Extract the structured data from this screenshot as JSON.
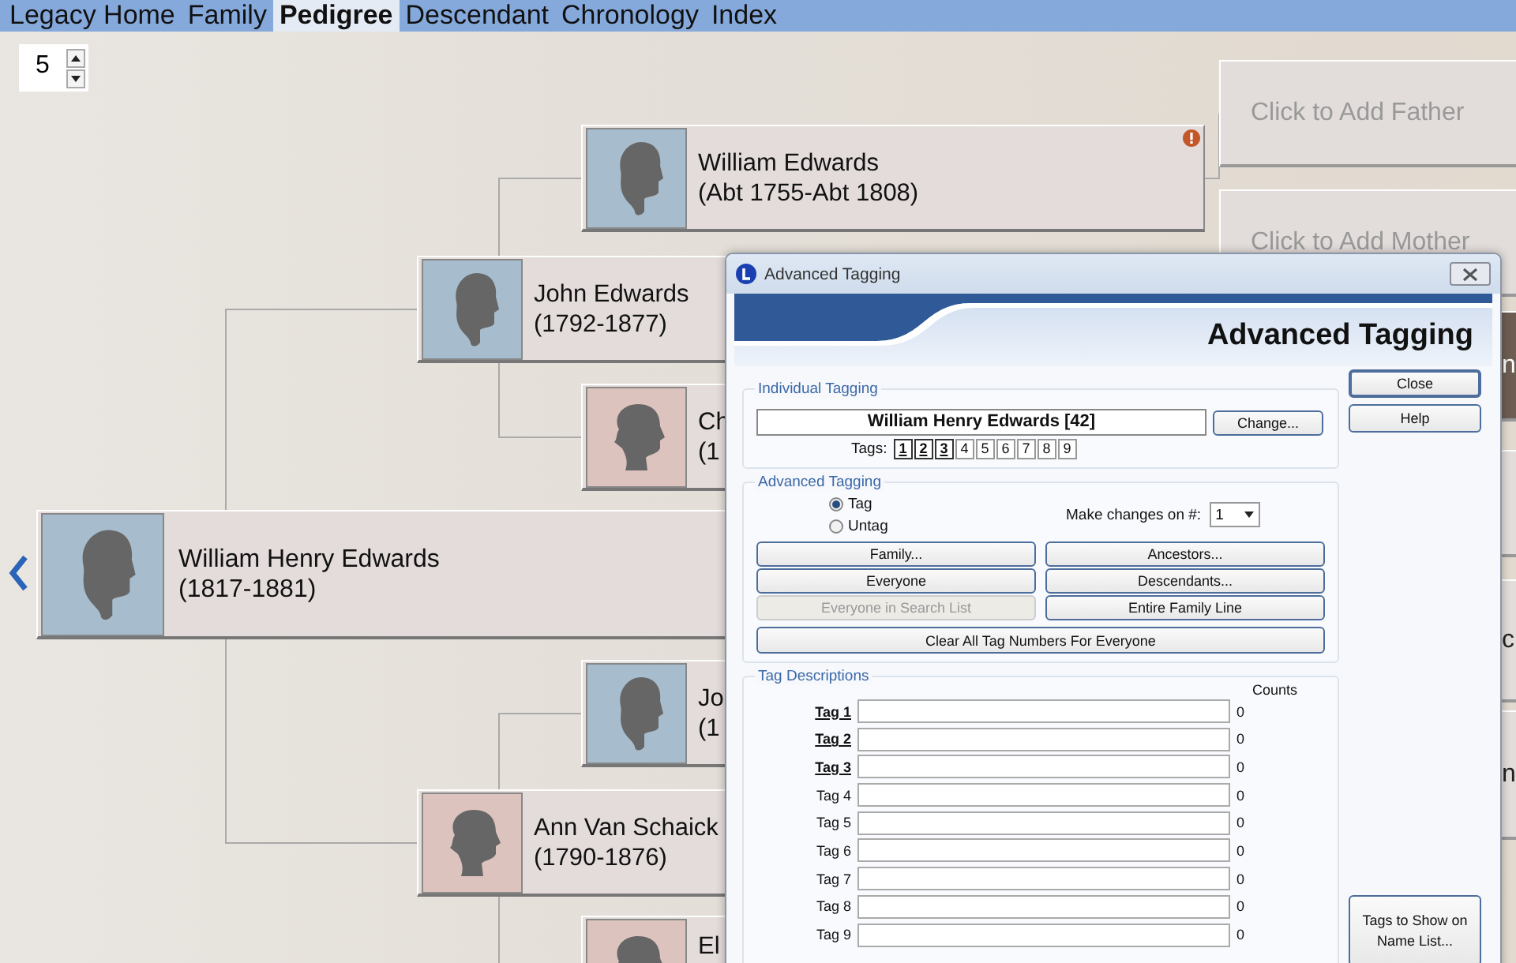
{
  "tabs": [
    {
      "label": "Legacy Home",
      "selected": false
    },
    {
      "label": "Family",
      "selected": false
    },
    {
      "label": "Pedigree",
      "selected": true
    },
    {
      "label": "Descendant",
      "selected": false
    },
    {
      "label": "Chronology",
      "selected": false
    },
    {
      "label": "Index",
      "selected": false
    }
  ],
  "generations": "5",
  "people": [
    {
      "name": "William Edwards",
      "dates": "(Abt 1755-Abt 1808)",
      "kind": "male",
      "alert": true
    },
    {
      "name": "John Edwards",
      "dates": "(1792-1877)",
      "kind": "male"
    },
    {
      "name": "Ch",
      "dates": "(1",
      "kind": "female"
    },
    {
      "name": "William Henry Edwards",
      "dates": "(1817-1881)",
      "kind": "male"
    },
    {
      "name": "Jo",
      "dates": "(1",
      "kind": "male"
    },
    {
      "name": "Ann Van Schaick",
      "dates": "(1790-1876)",
      "kind": "female"
    },
    {
      "name": "El",
      "kind": "female"
    }
  ],
  "add_boxes": [
    {
      "label": "Click to Add Father"
    },
    {
      "label": "Click to Add Mother"
    }
  ],
  "edge_boxes": [
    {
      "text": "n",
      "highlighted": true
    },
    {
      "highlighted": false
    },
    {
      "text": "c",
      "highlighted": false
    },
    {
      "text": "n",
      "highlighted": false
    }
  ],
  "dialog": {
    "title": "Advanced Tagging",
    "heading": "Advanced Tagging",
    "individual": {
      "legend": "Individual Tagging",
      "person": "William Henry Edwards [42]",
      "change": "Change...",
      "tags_label": "Tags:",
      "tags": [
        {
          "label": "1",
          "set": true
        },
        {
          "label": "2",
          "set": true
        },
        {
          "label": "3",
          "set": true
        },
        {
          "label": "4",
          "set": false
        },
        {
          "label": "5",
          "set": false
        },
        {
          "label": "6",
          "set": false
        },
        {
          "label": "7",
          "set": false
        },
        {
          "label": "8",
          "set": false
        },
        {
          "label": "9",
          "set": false
        }
      ]
    },
    "advanced": {
      "legend": "Advanced Tagging",
      "modes": [
        {
          "label": "Tag",
          "selected": true
        },
        {
          "label": "Untag",
          "selected": false
        }
      ],
      "make_changes_label": "Make changes on #:",
      "make_changes_value": "1",
      "buttons": [
        {
          "label": "Family...",
          "disabled": false
        },
        {
          "label": "Ancestors...",
          "disabled": false
        },
        {
          "label": "Everyone",
          "disabled": false
        },
        {
          "label": "Descendants...",
          "disabled": false
        },
        {
          "label": "Everyone in Search List",
          "disabled": true
        },
        {
          "label": "Entire Family Line",
          "disabled": false
        }
      ],
      "clear_button": "Clear All Tag Numbers For Everyone"
    },
    "descriptions": {
      "legend": "Tag Descriptions",
      "counts_label": "Counts",
      "rows": [
        {
          "label": "Tag 1",
          "in_use": true,
          "count": "0"
        },
        {
          "label": "Tag 2",
          "in_use": true,
          "count": "0"
        },
        {
          "label": "Tag 3",
          "in_use": true,
          "count": "0"
        },
        {
          "label": "Tag 4",
          "in_use": false,
          "count": "0"
        },
        {
          "label": "Tag 5",
          "in_use": false,
          "count": "0"
        },
        {
          "label": "Tag 6",
          "in_use": false,
          "count": "0"
        },
        {
          "label": "Tag 7",
          "in_use": false,
          "count": "0"
        },
        {
          "label": "Tag 8",
          "in_use": false,
          "count": "0"
        },
        {
          "label": "Tag 9",
          "in_use": false,
          "count": "0"
        }
      ]
    },
    "side_buttons": [
      "Close",
      "Help"
    ],
    "name_list_button": "Tags to Show on Name List..."
  }
}
